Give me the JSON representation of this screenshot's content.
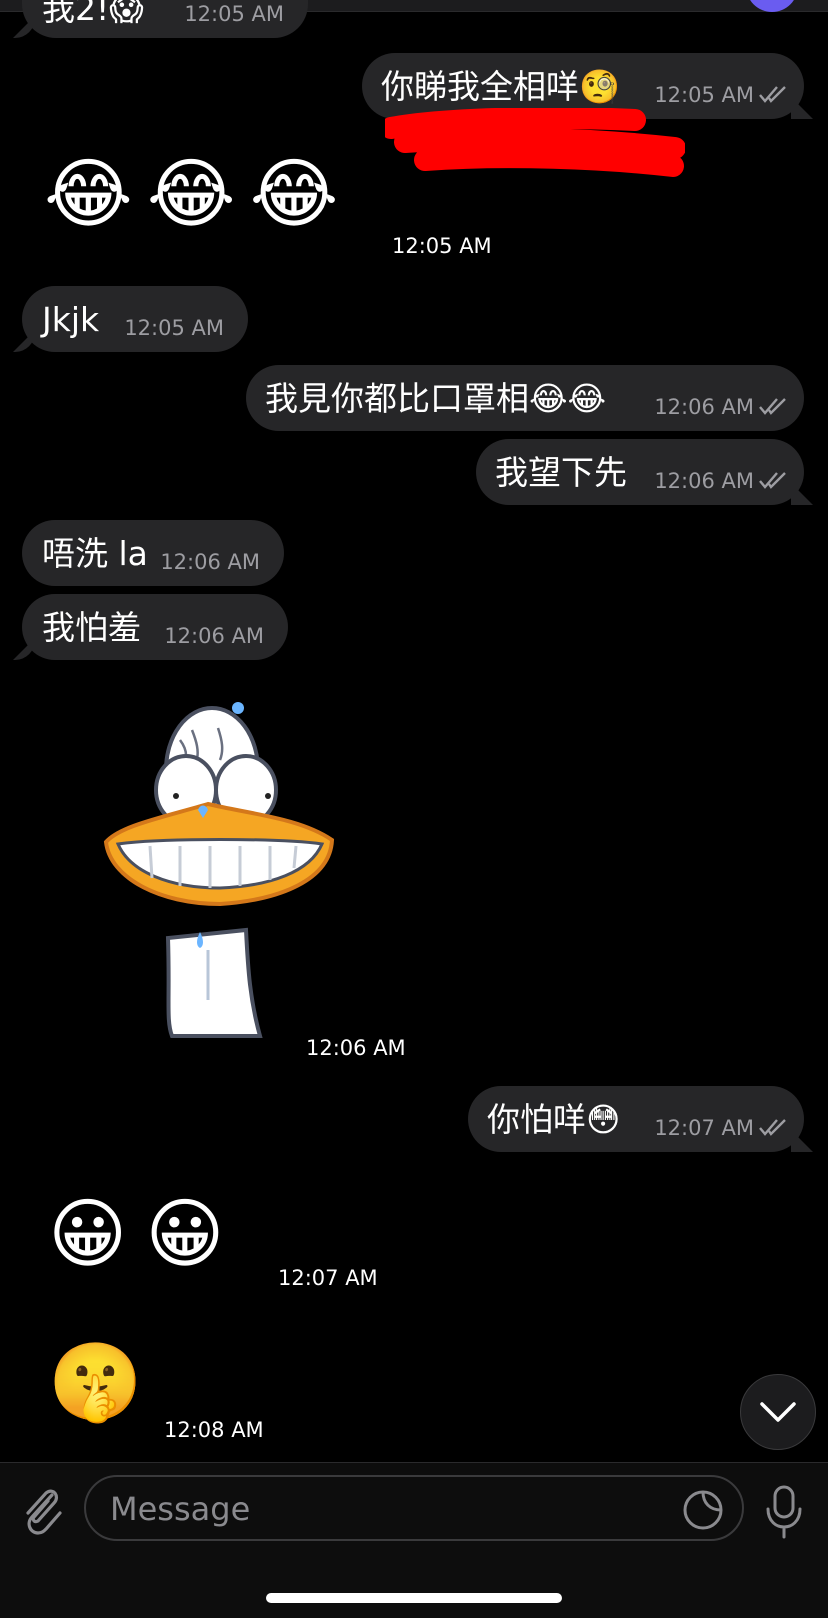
{
  "messages": {
    "m0": {
      "text": "我2!😱",
      "time": "12:05 AM"
    },
    "m1": {
      "text": "你睇我全相咩🧐",
      "time": "12:05 AM"
    },
    "m2": {
      "emoji": "😂😂😂",
      "time": "12:05 AM"
    },
    "m3": {
      "text": "Jkjk",
      "time": "12:05 AM"
    },
    "m4": {
      "text": "我見你都比口罩相😂😂",
      "time": "12:06 AM"
    },
    "m5": {
      "text": "我望下先",
      "time": "12:06 AM"
    },
    "m6": {
      "text": "唔洗 la",
      "time": "12:06 AM"
    },
    "m7": {
      "text": "我怕羞",
      "time": "12:06 AM"
    },
    "m8": {
      "sticker": "duck-grin-sticker",
      "time": "12:06 AM"
    },
    "m9": {
      "text": "你怕咩😳",
      "time": "12:07 AM"
    },
    "m10": {
      "emoji": "😀😀",
      "time": "12:07 AM"
    },
    "m11": {
      "emoji": "🤫",
      "time": "12:08 AM"
    }
  },
  "composer": {
    "placeholder": "Message"
  },
  "icons": {
    "attach": "paperclip-icon",
    "sticker": "sticker-icon",
    "mic": "microphone-icon",
    "scroll": "chevron-down-icon",
    "read": "double-check-icon"
  },
  "colors": {
    "background": "#000000",
    "bubble": "#262628",
    "timestamp": "#9d9da2",
    "redact": "#ff0000",
    "avatar_accent": "#6a5cf0"
  }
}
